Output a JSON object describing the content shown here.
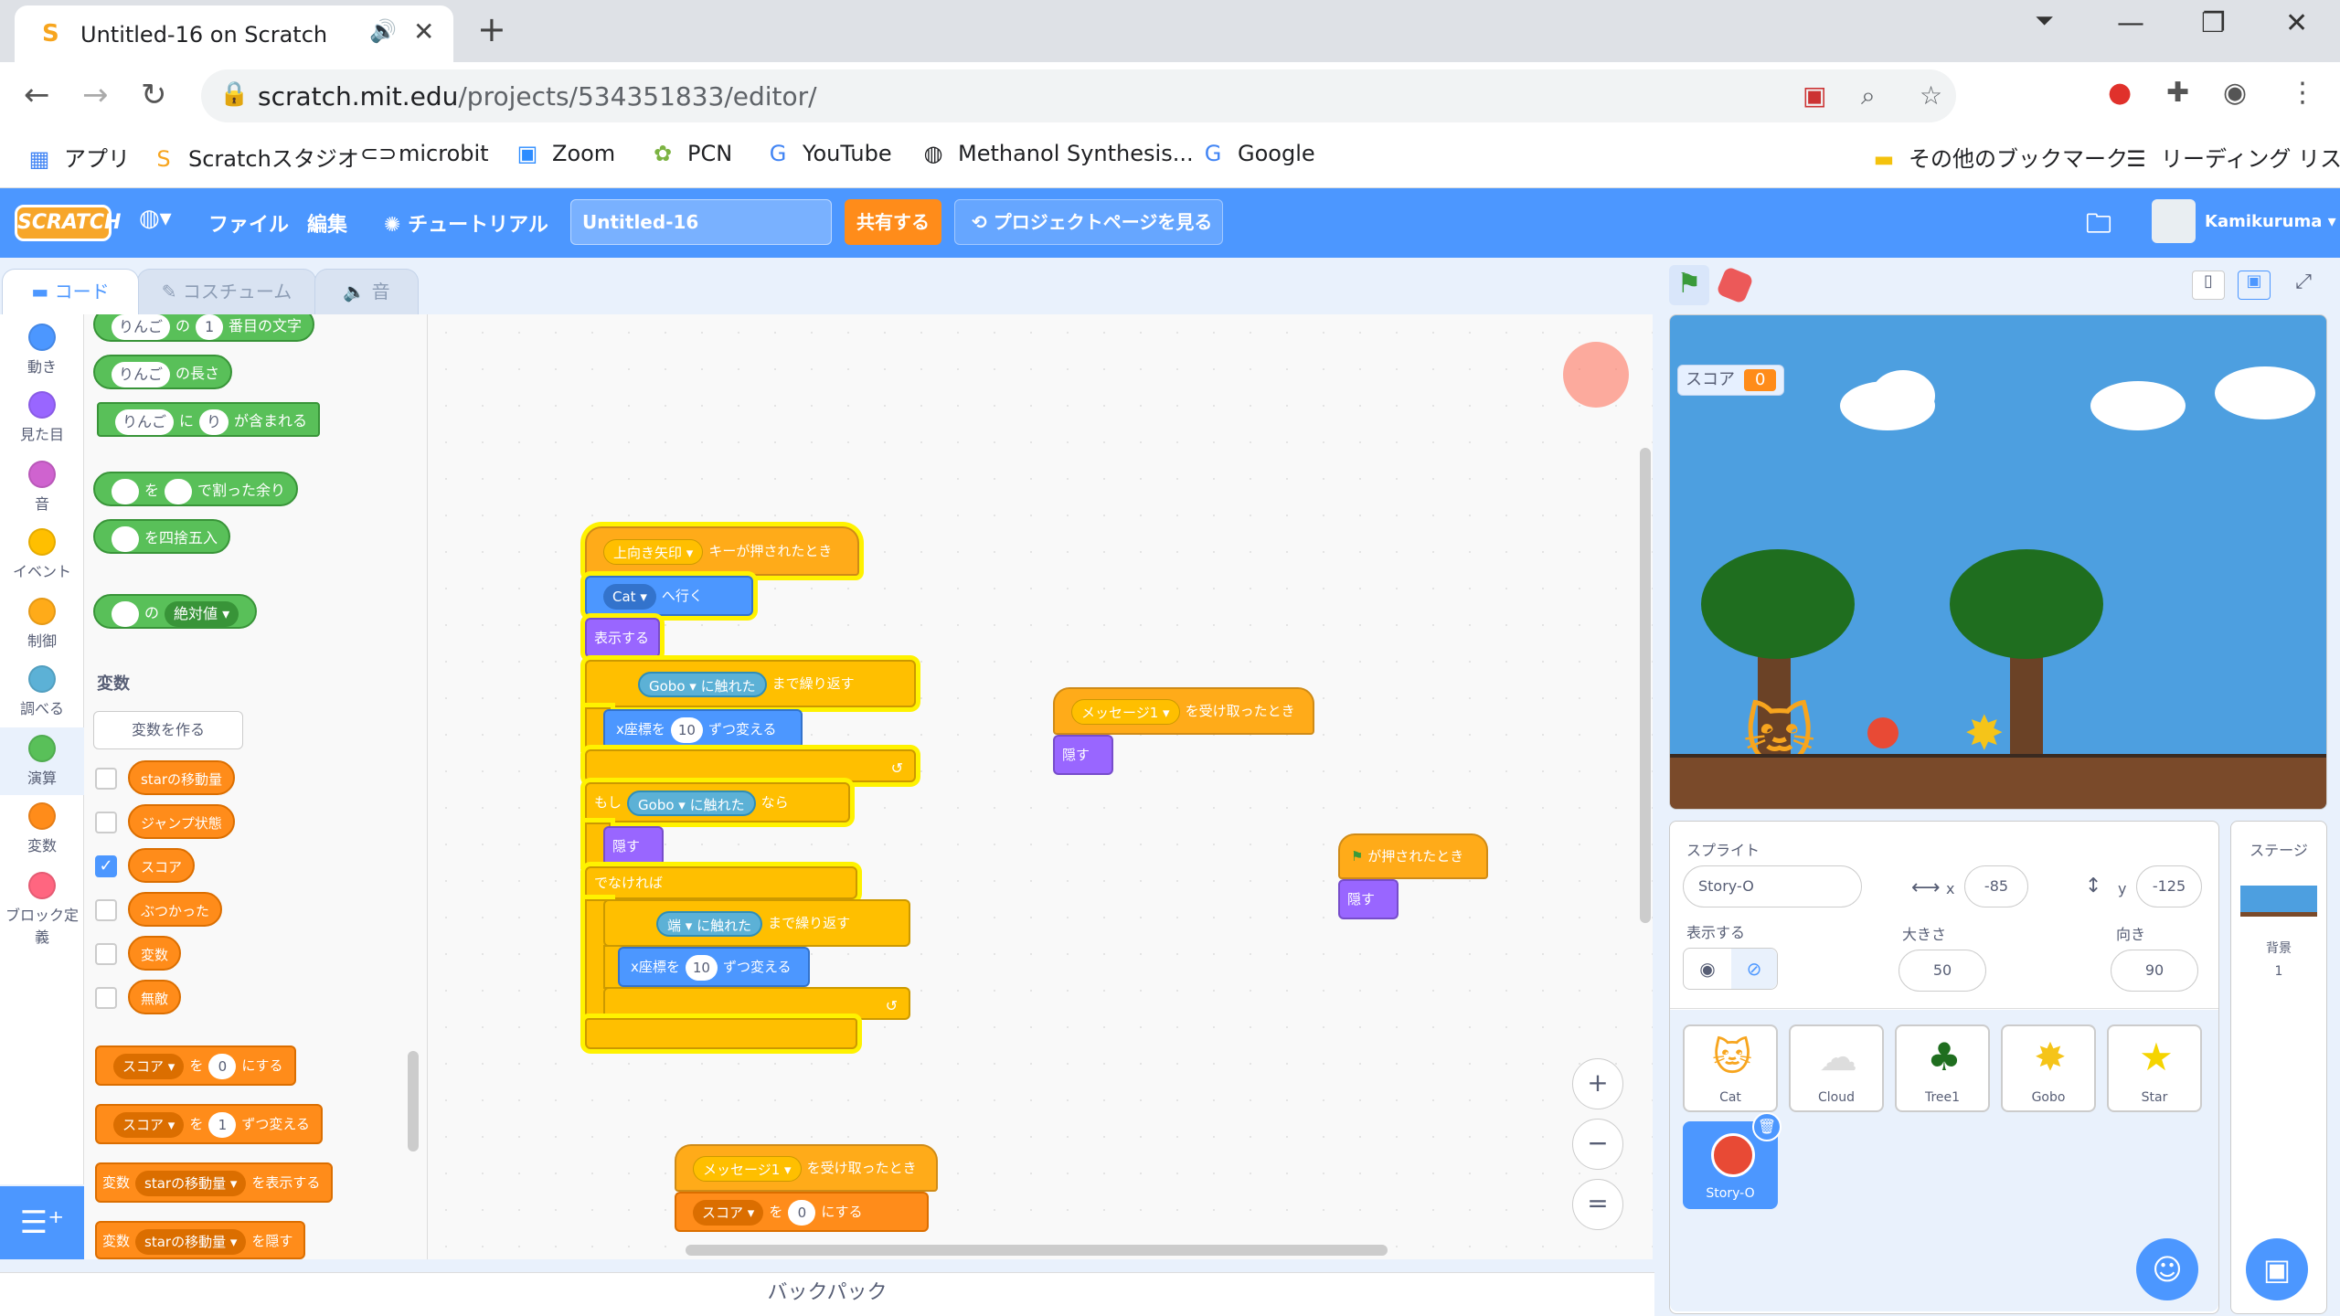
{
  "browser": {
    "tab_title": "Untitled-16 on Scratch",
    "url_host": "scratch.mit.edu",
    "url_path": "/projects/534351833/editor/",
    "bookmarks": [
      "アプリ",
      "Scratchスタジオ",
      "microbit",
      "Zoom",
      "PCN",
      "YouTube",
      "Methanol Synthesis...",
      "Google"
    ],
    "other_bookmarks": "その他のブックマーク",
    "reading_list": "リーディング リスト"
  },
  "menubar": {
    "logo": "SCRATCH",
    "file": "ファイル",
    "edit": "編集",
    "tutorial": "チュートリアル",
    "project_title": "Untitled-16",
    "share": "共有する",
    "see_project": "プロジェクトページを見る",
    "username": "Kamikuruma"
  },
  "editor_tabs": [
    "コード",
    "コスチューム",
    "音"
  ],
  "categories": [
    {
      "label": "動き",
      "color": "#4c97ff"
    },
    {
      "label": "見た目",
      "color": "#9966ff"
    },
    {
      "label": "音",
      "color": "#cf63cf"
    },
    {
      "label": "イベント",
      "color": "#ffbf00"
    },
    {
      "label": "制御",
      "color": "#ffab19"
    },
    {
      "label": "調べる",
      "color": "#5cb1d6"
    },
    {
      "label": "演算",
      "color": "#59c059"
    },
    {
      "label": "変数",
      "color": "#ff8c1a"
    },
    {
      "label": "ブロック定義",
      "color": "#ff6680"
    }
  ],
  "palette": {
    "op_letter": {
      "text1": "りんご",
      "text2": "の",
      "num": "1",
      "text3": "番目の文字"
    },
    "op_length": {
      "text1": "りんご",
      "text2": "の長さ"
    },
    "op_contains": {
      "text1": "りんご",
      "text2": "に",
      "text3": "り",
      "text4": "が含まれる"
    },
    "op_mod": {
      "text1": "を",
      "text2": "で割った余り"
    },
    "op_round": {
      "text1": "を四捨五入"
    },
    "op_abs": {
      "text1": "の",
      "dd": "絶対値"
    },
    "variables_heading": "変数",
    "make_var": "変数を作る",
    "vars": [
      {
        "name": "starの移動量",
        "checked": false
      },
      {
        "name": "ジャンプ状態",
        "checked": false
      },
      {
        "name": "スコア",
        "checked": true
      },
      {
        "name": "ぶつかった",
        "checked": false
      },
      {
        "name": "変数",
        "checked": false
      },
      {
        "name": "無敵",
        "checked": false
      }
    ],
    "set_block": {
      "var": "スコア",
      "t1": "を",
      "val": "0",
      "t2": "にする"
    },
    "change_block": {
      "var": "スコア",
      "t1": "を",
      "val": "1",
      "t2": "ずつ変える"
    },
    "show_var": {
      "t0": "変数",
      "var": "starの移動量",
      "t1": "を表示する"
    },
    "hide_var": {
      "t0": "変数",
      "var": "starの移動量",
      "t1": "を隠す"
    }
  },
  "script1": {
    "hat": {
      "dd": "上向き矢印",
      "text": "キーが押されたとき"
    },
    "goto": {
      "dd": "Cat",
      "text": "へ行く"
    },
    "show": "表示する",
    "repeat_until1": {
      "dd": "Gobo",
      "t1": "に触れた",
      "t2": "まで繰り返す"
    },
    "change_x1": {
      "t1": "x座標を",
      "val": "10",
      "t2": "ずつ変える"
    },
    "if": {
      "t0": "もし",
      "dd": "Gobo",
      "t1": "に触れた",
      "t2": "なら"
    },
    "hide": "隠す",
    "else": "でなければ",
    "repeat_until2": {
      "dd": "端",
      "t1": "に触れた",
      "t2": "まで繰り返す"
    },
    "change_x2": {
      "t1": "x座標を",
      "val": "10",
      "t2": "ずつ変える"
    }
  },
  "script2": {
    "hat": {
      "dd": "メッセージ1",
      "text": "を受け取ったとき"
    },
    "hide": "隠す"
  },
  "script3": {
    "hat": "が押されたとき",
    "hide": "隠す"
  },
  "script4": {
    "hat": {
      "dd": "メッセージ1",
      "text": "を受け取ったとき"
    },
    "set": {
      "var": "スコア",
      "t1": "を",
      "val": "0",
      "t2": "にする"
    }
  },
  "backpack": "バックパック",
  "stage_monitor": {
    "label": "スコア",
    "value": "0"
  },
  "sprite_info": {
    "sprite_label": "スプライト",
    "sprite_name": "Story-O",
    "x_label": "x",
    "x": "-85",
    "y_label": "y",
    "y": "-125",
    "show_label": "表示する",
    "size_label": "大きさ",
    "size": "50",
    "dir_label": "向き",
    "direction": "90"
  },
  "sprites": [
    "Cat",
    "Cloud",
    "Tree1",
    "Gobo",
    "Star",
    "Story-O"
  ],
  "stage_panel": {
    "title": "ステージ",
    "backdrops_label": "背景",
    "backdrops_count": "1"
  }
}
